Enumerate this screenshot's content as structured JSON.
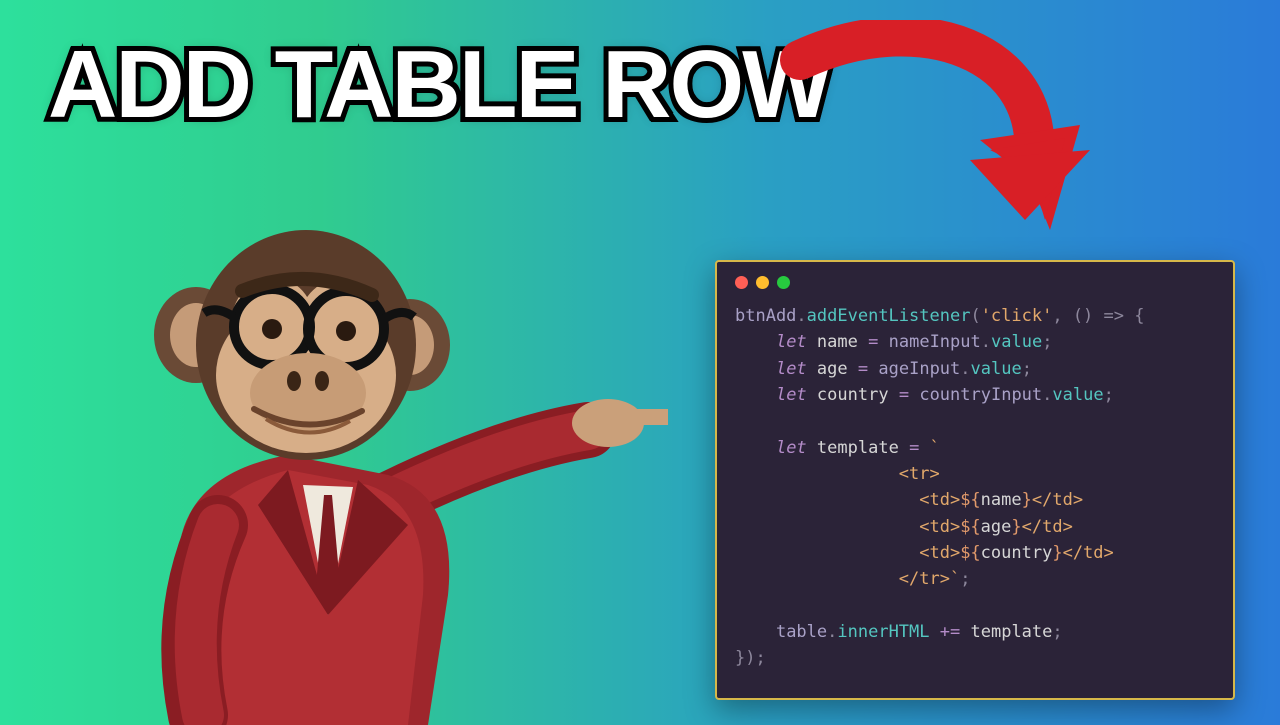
{
  "title": "ADD TABLE ROW",
  "code": {
    "tokens": {
      "btnAdd": "btnAdd",
      "addEventListener": "addEventListener",
      "click": "'click'",
      "let": "let",
      "name": "name",
      "nameInput": "nameInput",
      "value": "value",
      "age": "age",
      "ageInput": "ageInput",
      "country": "country",
      "countryInput": "countryInput",
      "template": "template",
      "trOpen": "<tr>",
      "tdOpen": "<td>",
      "tdClose": "</td>",
      "trClose": "</tr>",
      "table": "table",
      "innerHTML": "innerHTML"
    }
  },
  "traffic": {
    "red": "close",
    "yellow": "minimize",
    "green": "zoom"
  }
}
